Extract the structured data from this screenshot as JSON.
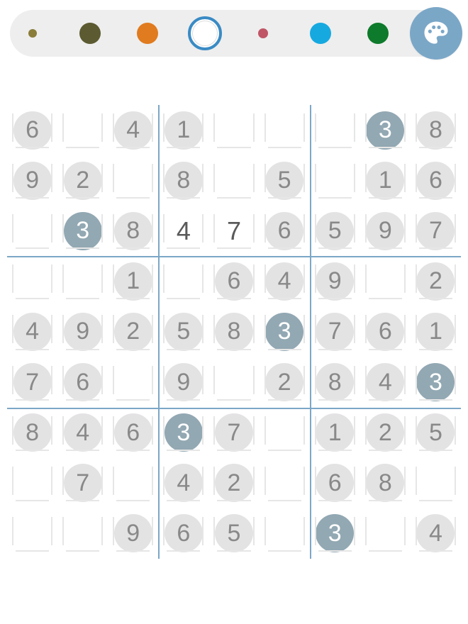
{
  "palette": {
    "swatches": [
      {
        "name": "olive-small",
        "dot_size": 12,
        "fill": "#8a7d3a",
        "selected": false
      },
      {
        "name": "black-olive",
        "dot_size": 30,
        "fill": "#5c5a30",
        "selected": false
      },
      {
        "name": "orange",
        "dot_size": 30,
        "fill": "#e07b1f",
        "selected": false
      },
      {
        "name": "white",
        "dot_size": 36,
        "fill": "#ffffff",
        "selected": true
      },
      {
        "name": "pink-small",
        "dot_size": 14,
        "fill": "#c05566",
        "selected": false
      },
      {
        "name": "cyan",
        "dot_size": 30,
        "fill": "#16a9e0",
        "selected": false
      },
      {
        "name": "green",
        "dot_size": 30,
        "fill": "#0e7a2b",
        "selected": false
      },
      {
        "name": "purple",
        "dot_size": 30,
        "fill": "#6a2bb0",
        "selected": false
      }
    ],
    "button_icon": "palette-icon"
  },
  "board": {
    "highlight_value": "3",
    "rows": [
      [
        {
          "v": "6",
          "t": "given"
        },
        {
          "v": "",
          "t": "empty"
        },
        {
          "v": "4",
          "t": "given"
        },
        {
          "v": "1",
          "t": "given"
        },
        {
          "v": "",
          "t": "empty"
        },
        {
          "v": "",
          "t": "empty"
        },
        {
          "v": "",
          "t": "empty"
        },
        {
          "v": "3",
          "t": "hl"
        },
        {
          "v": "8",
          "t": "given"
        }
      ],
      [
        {
          "v": "9",
          "t": "given"
        },
        {
          "v": "2",
          "t": "given"
        },
        {
          "v": "",
          "t": "empty"
        },
        {
          "v": "8",
          "t": "given"
        },
        {
          "v": "",
          "t": "empty"
        },
        {
          "v": "5",
          "t": "given"
        },
        {
          "v": "",
          "t": "empty"
        },
        {
          "v": "1",
          "t": "given"
        },
        {
          "v": "6",
          "t": "given"
        }
      ],
      [
        {
          "v": "",
          "t": "empty"
        },
        {
          "v": "3",
          "t": "hl"
        },
        {
          "v": "8",
          "t": "given"
        },
        {
          "v": "4",
          "t": "user"
        },
        {
          "v": "7",
          "t": "user"
        },
        {
          "v": "6",
          "t": "given"
        },
        {
          "v": "5",
          "t": "given"
        },
        {
          "v": "9",
          "t": "given"
        },
        {
          "v": "7",
          "t": "given"
        }
      ],
      [
        {
          "v": "",
          "t": "empty"
        },
        {
          "v": "",
          "t": "empty"
        },
        {
          "v": "1",
          "t": "given"
        },
        {
          "v": "",
          "t": "empty"
        },
        {
          "v": "6",
          "t": "given"
        },
        {
          "v": "4",
          "t": "given"
        },
        {
          "v": "9",
          "t": "given"
        },
        {
          "v": "",
          "t": "empty"
        },
        {
          "v": "2",
          "t": "given"
        }
      ],
      [
        {
          "v": "4",
          "t": "given"
        },
        {
          "v": "9",
          "t": "given"
        },
        {
          "v": "2",
          "t": "given"
        },
        {
          "v": "5",
          "t": "given"
        },
        {
          "v": "8",
          "t": "given"
        },
        {
          "v": "3",
          "t": "hl"
        },
        {
          "v": "7",
          "t": "given"
        },
        {
          "v": "6",
          "t": "given"
        },
        {
          "v": "1",
          "t": "given"
        }
      ],
      [
        {
          "v": "7",
          "t": "given"
        },
        {
          "v": "6",
          "t": "given"
        },
        {
          "v": "",
          "t": "empty"
        },
        {
          "v": "9",
          "t": "given"
        },
        {
          "v": "",
          "t": "empty"
        },
        {
          "v": "2",
          "t": "given"
        },
        {
          "v": "8",
          "t": "given"
        },
        {
          "v": "4",
          "t": "given"
        },
        {
          "v": "3",
          "t": "hl"
        }
      ],
      [
        {
          "v": "8",
          "t": "given"
        },
        {
          "v": "4",
          "t": "given"
        },
        {
          "v": "6",
          "t": "given"
        },
        {
          "v": "3",
          "t": "hl"
        },
        {
          "v": "7",
          "t": "given"
        },
        {
          "v": "",
          "t": "empty"
        },
        {
          "v": "1",
          "t": "given"
        },
        {
          "v": "2",
          "t": "given"
        },
        {
          "v": "5",
          "t": "given"
        }
      ],
      [
        {
          "v": "",
          "t": "empty"
        },
        {
          "v": "7",
          "t": "given"
        },
        {
          "v": "",
          "t": "empty"
        },
        {
          "v": "4",
          "t": "given"
        },
        {
          "v": "2",
          "t": "given"
        },
        {
          "v": "",
          "t": "empty"
        },
        {
          "v": "6",
          "t": "given"
        },
        {
          "v": "8",
          "t": "given"
        },
        {
          "v": "",
          "t": "empty"
        }
      ],
      [
        {
          "v": "",
          "t": "empty"
        },
        {
          "v": "",
          "t": "empty"
        },
        {
          "v": "9",
          "t": "given"
        },
        {
          "v": "6",
          "t": "given"
        },
        {
          "v": "5",
          "t": "given"
        },
        {
          "v": "",
          "t": "empty"
        },
        {
          "v": "3",
          "t": "hl"
        },
        {
          "v": "",
          "t": "empty"
        },
        {
          "v": "4",
          "t": "given"
        }
      ]
    ]
  }
}
